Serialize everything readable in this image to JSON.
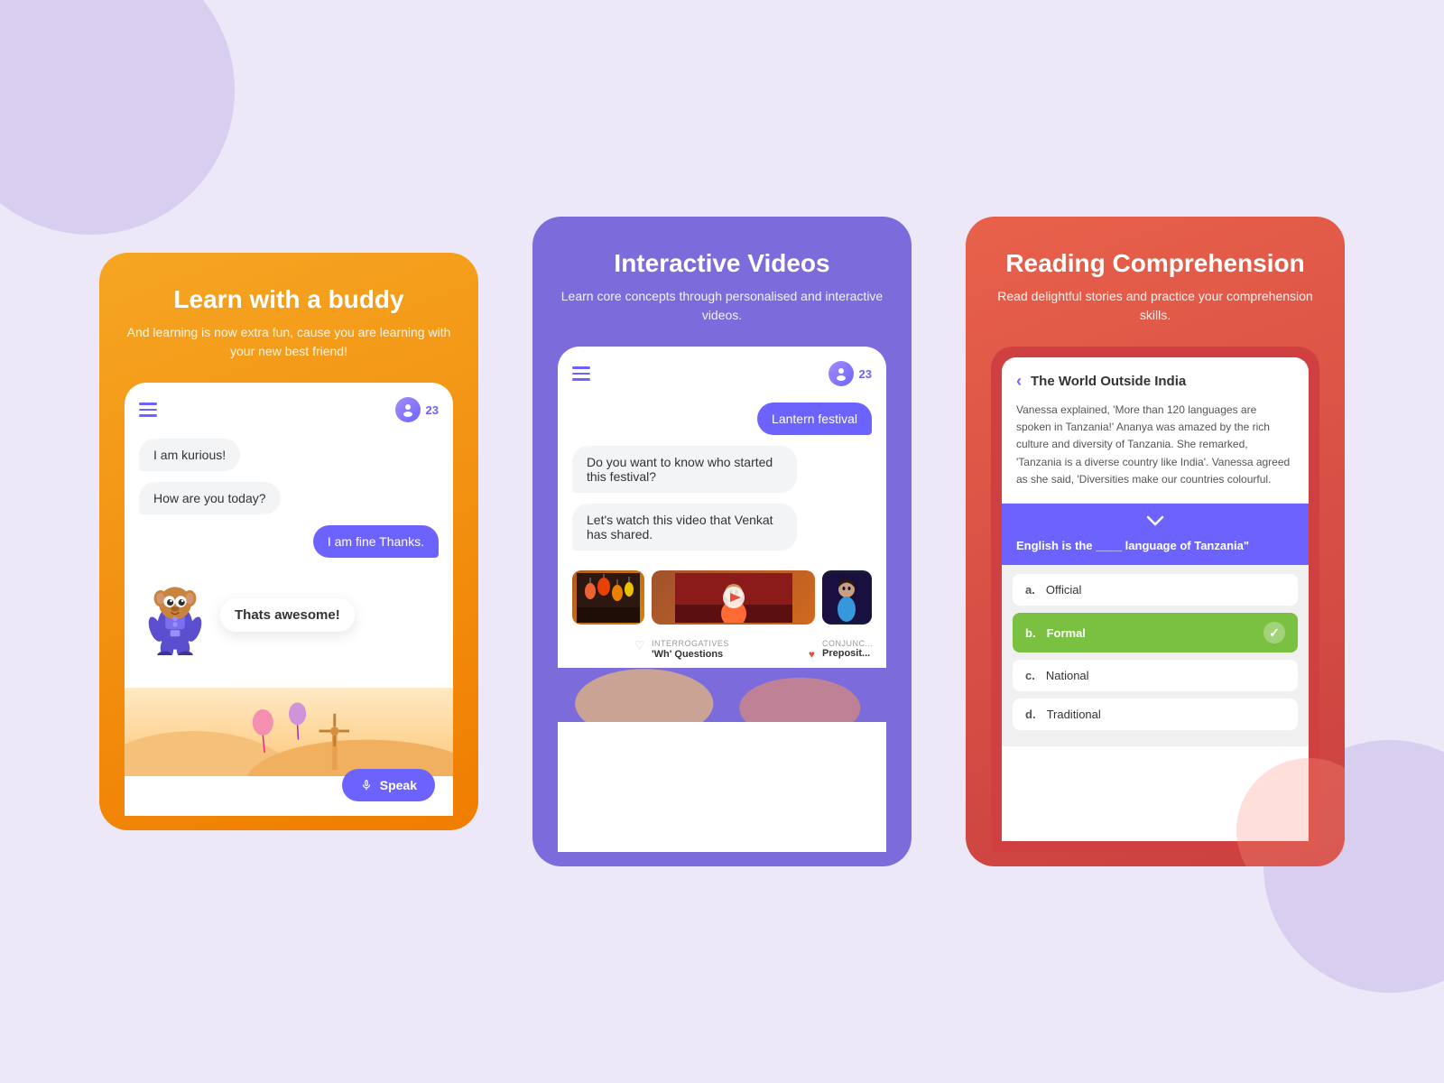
{
  "page": {
    "background_color": "#ede8f8"
  },
  "card1": {
    "title": "Learn with a buddy",
    "subtitle": "And learning is now extra fun, cause you are learning with your new best friend!",
    "chat": {
      "messages": [
        {
          "text": "I am kurious!",
          "type": "left"
        },
        {
          "text": "How are you today?",
          "type": "left"
        },
        {
          "text": "I am fine Thanks.",
          "type": "right"
        }
      ],
      "mascot_response": "Thats awesome!"
    },
    "speak_button": "Speak",
    "badge_number": "23"
  },
  "card2": {
    "title": "Interactive Videos",
    "subtitle": "Learn core concepts through personalised and interactive videos.",
    "chat": {
      "messages": [
        {
          "text": "Lantern festival",
          "type": "right"
        },
        {
          "text": "Do you want to know who started this festival?",
          "type": "left"
        },
        {
          "text": "Let's watch this video that Venkat has shared.",
          "type": "left"
        }
      ]
    },
    "videos": [
      {
        "category": "",
        "title": "",
        "liked": false
      },
      {
        "category": "INTERROGATIVES",
        "title": "'Wh' Questions",
        "liked": true
      },
      {
        "category": "CONJUNC...",
        "title": "Preposit...",
        "liked": false
      }
    ],
    "badge_number": "23"
  },
  "card3": {
    "title": "Reading Comprehension",
    "subtitle": "Read delightful stories and practice your comprehension skills.",
    "story": {
      "title": "The World Outside India",
      "back_label": "‹",
      "text": "Vanessa explained, 'More than 120 languages are spoken in Tanzania!' Ananya was amazed by the rich culture and diversity of Tanzania. She remarked, 'Tanzania is a diverse country like India'. Vanessa agreed as she said, 'Diversities make our countries colourful."
    },
    "question": {
      "dropdown_arrow": "˅",
      "text": "English is the ____ language of Tanzania\""
    },
    "options": [
      {
        "letter": "a.",
        "text": "Official",
        "correct": false
      },
      {
        "letter": "b.",
        "text": "Formal",
        "correct": true
      },
      {
        "letter": "c.",
        "text": "National",
        "correct": false
      },
      {
        "letter": "d.",
        "text": "Traditional",
        "correct": false
      }
    ]
  }
}
